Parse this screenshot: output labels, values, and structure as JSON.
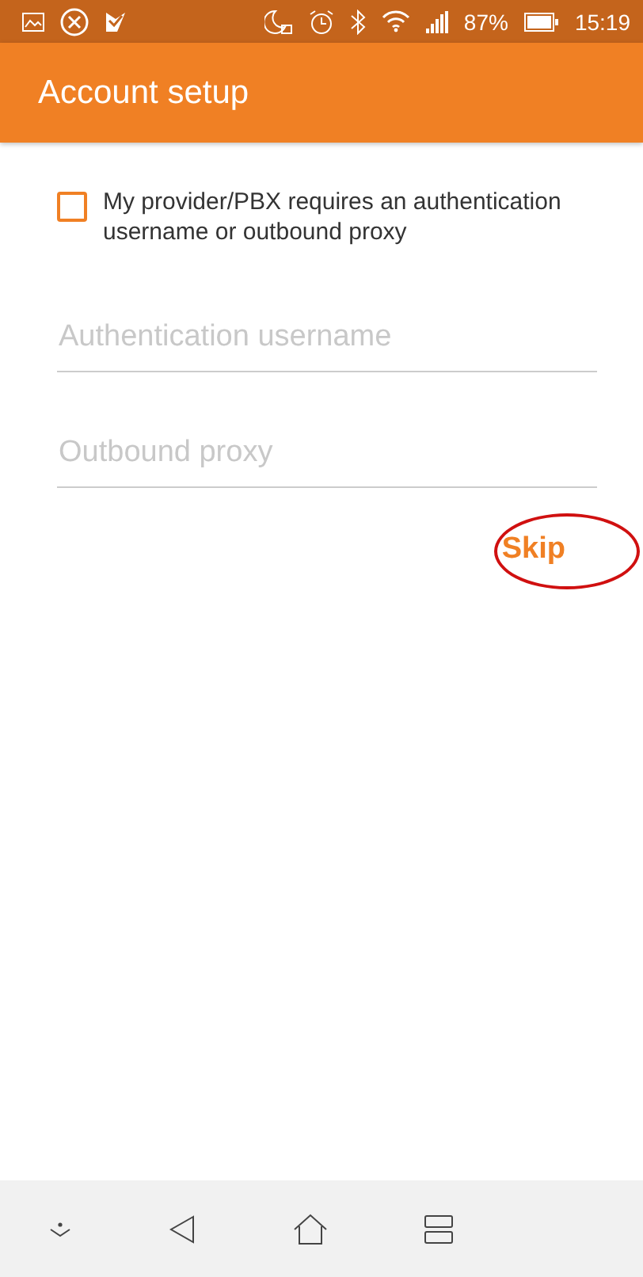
{
  "status_bar": {
    "battery": "87%",
    "time": "15:19"
  },
  "app_bar": {
    "title": "Account setup"
  },
  "option": {
    "label": "My provider/PBX requires an authentication username or outbound proxy",
    "checked": false
  },
  "fields": [
    {
      "placeholder": "Authentication username"
    },
    {
      "placeholder": "Outbound proxy"
    }
  ],
  "skip_button": {
    "label": "Skip",
    "highlighted": true
  }
}
